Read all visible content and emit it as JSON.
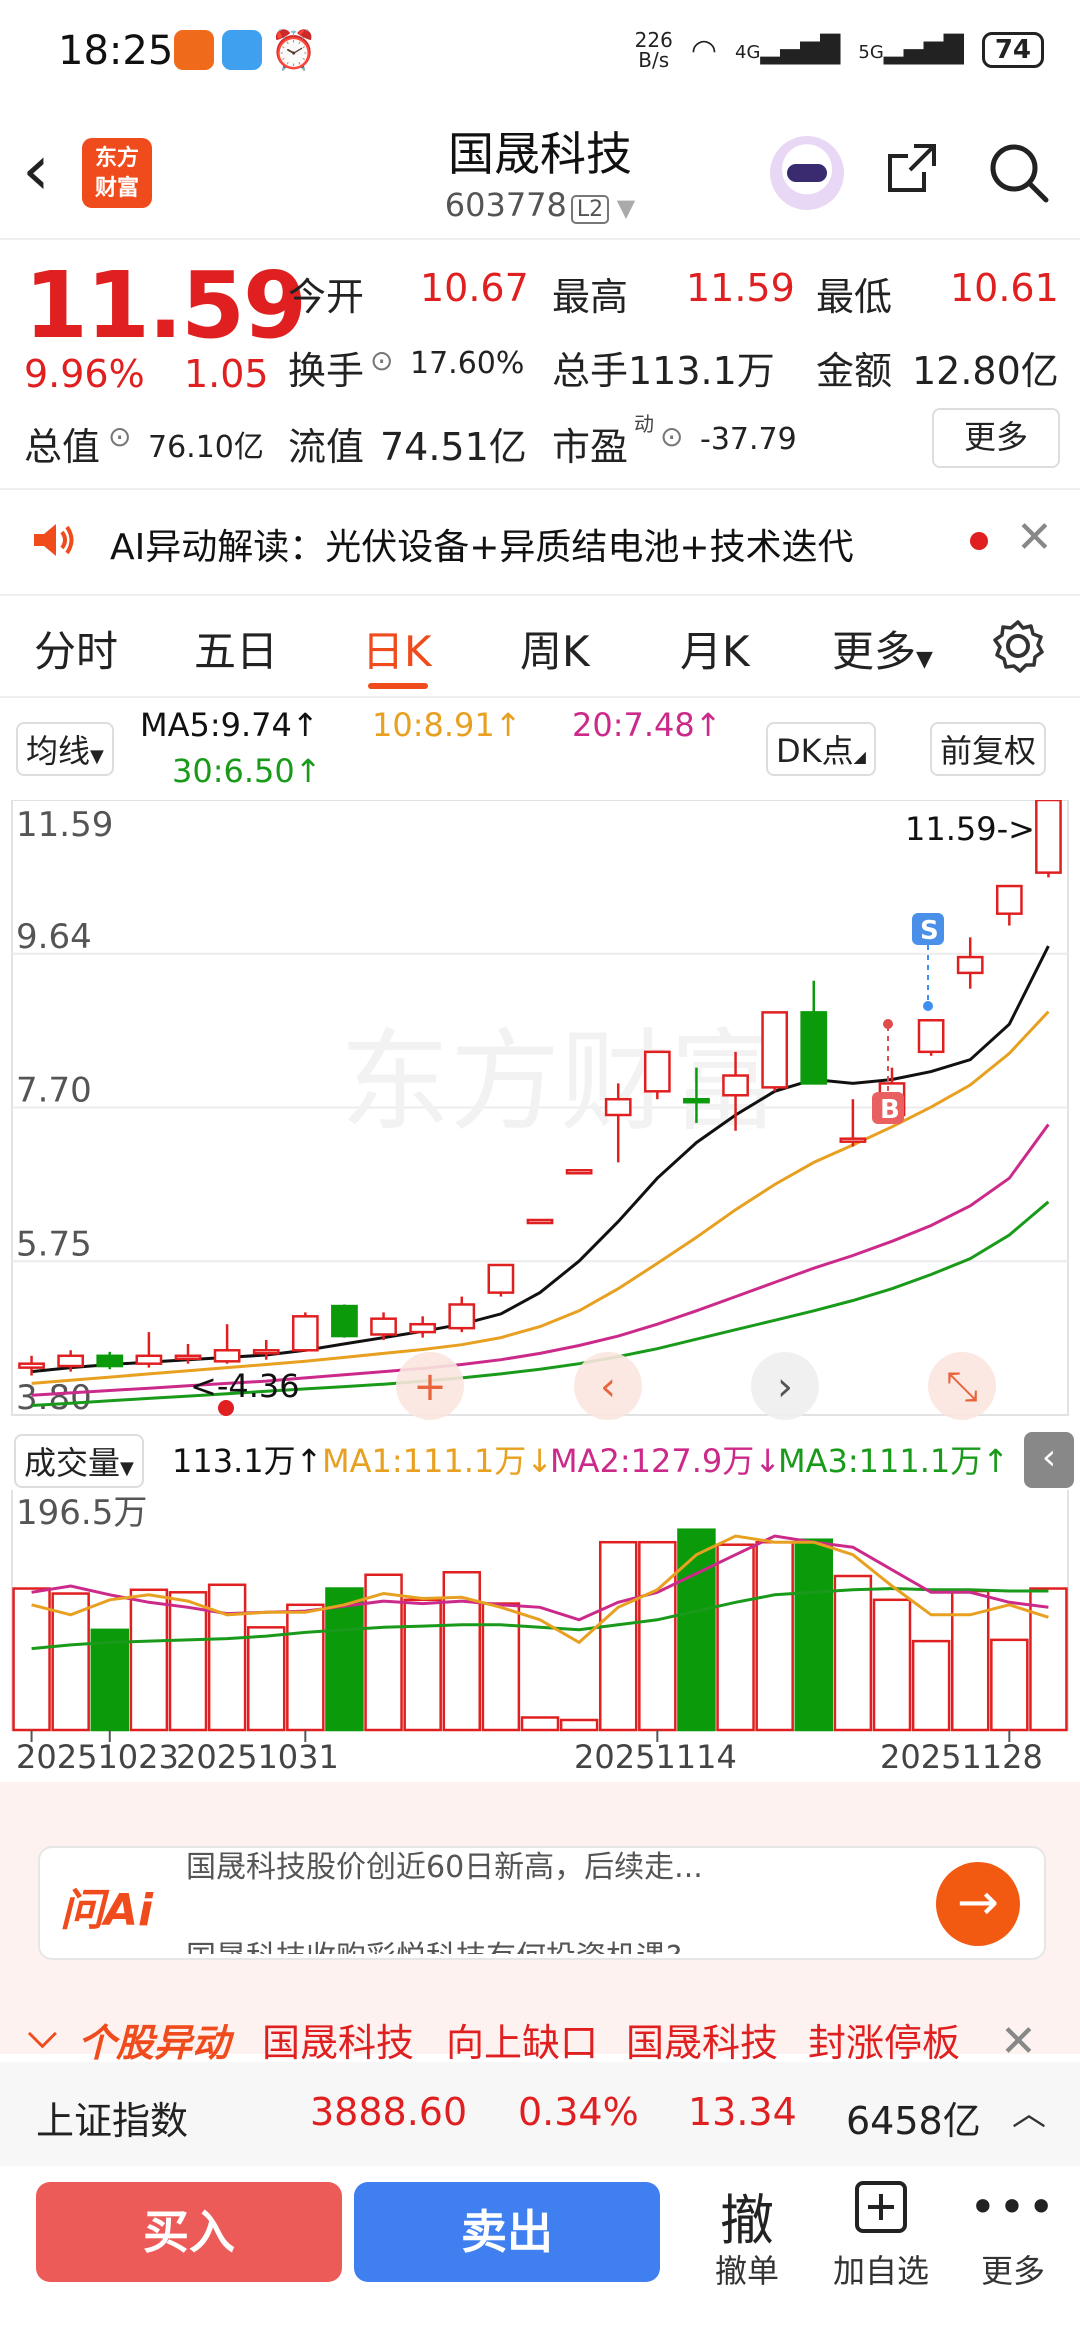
{
  "status_bar": {
    "time": "18:25",
    "net_speed_top": "226",
    "net_speed_bottom": "B/s",
    "sig1": "4G",
    "sig2": "5G",
    "battery": "74"
  },
  "header": {
    "logo_text": "东方财富",
    "stock_name": "国晟科技",
    "stock_code": "603778",
    "level_badge": "L2"
  },
  "quote": {
    "price": "11.59",
    "change_pct": "9.96%",
    "change": "1.05",
    "open_label": "今开",
    "open": "10.67",
    "high_label": "最高",
    "high": "11.59",
    "low_label": "最低",
    "low": "10.61",
    "turnover_label": "换手",
    "turnover": "17.60%",
    "volume_label": "总手",
    "volume": "113.1万",
    "amount_label": "金额",
    "amount": "12.80亿",
    "total_cap_label": "总值",
    "total_cap": "76.10亿",
    "float_cap_label": "流值",
    "float_cap": "74.51亿",
    "pe_label": "市盈",
    "pe_sup": "动",
    "pe": "-37.79",
    "more_label": "更多"
  },
  "ai_banner": {
    "text": "AI异动解读：光伏设备+异质结电池+技术迭代"
  },
  "tabs": [
    {
      "label": "分时"
    },
    {
      "label": "五日"
    },
    {
      "label": "日K"
    },
    {
      "label": "周K"
    },
    {
      "label": "月K"
    },
    {
      "label": "更多"
    }
  ],
  "ma_indicator": {
    "selector": "均线",
    "ma5": "MA5:9.74↑",
    "ma10": "10:8.91↑",
    "ma20": "20:7.48↑",
    "ma30": "30:6.50↑",
    "dk_button": "DK点",
    "adjust_button": "前复权"
  },
  "vol_indicator": {
    "selector": "成交量",
    "vol": "113.1万↑",
    "ma1": "MA1:111.1万↓",
    "ma2": "MA2:127.9万↓",
    "ma3": "MA3:111.1万↑",
    "top_label": "196.5万"
  },
  "colors": {
    "up": "#e02020",
    "down": "#0a9a0a",
    "ma5": "#111111",
    "ma10": "#e8a020",
    "ma20": "#cc2a8a",
    "ma30": "#1a9a1a",
    "brand": "#f04b1c"
  },
  "chart_data": {
    "type": "candlestick",
    "y_ticks": [
      "11.59",
      "9.64",
      "7.70",
      "5.75",
      "3.80"
    ],
    "ylim": [
      3.8,
      11.59
    ],
    "x_ticks": [
      "20251023",
      "20251031",
      "20251114",
      "20251128"
    ],
    "max_marker": "11.59->",
    "min_marker": "<-4.36",
    "signal_sell": "S",
    "signal_buy": "B",
    "candles": [
      {
        "o": 4.4,
        "c": 4.45,
        "h": 4.55,
        "l": 4.3
      },
      {
        "o": 4.42,
        "c": 4.55,
        "h": 4.62,
        "l": 4.35
      },
      {
        "o": 4.55,
        "c": 4.42,
        "h": 4.6,
        "l": 4.38
      },
      {
        "o": 4.45,
        "c": 4.55,
        "h": 4.85,
        "l": 4.4
      },
      {
        "o": 4.52,
        "c": 4.55,
        "h": 4.7,
        "l": 4.45
      },
      {
        "o": 4.48,
        "c": 4.62,
        "h": 4.95,
        "l": 4.45
      },
      {
        "o": 4.6,
        "c": 4.62,
        "h": 4.75,
        "l": 4.5
      },
      {
        "o": 4.62,
        "c": 5.05,
        "h": 5.1,
        "l": 4.6
      },
      {
        "o": 5.18,
        "c": 4.8,
        "h": 5.2,
        "l": 4.78
      },
      {
        "o": 4.82,
        "c": 5.02,
        "h": 5.1,
        "l": 4.75
      },
      {
        "o": 4.85,
        "c": 4.95,
        "h": 5.05,
        "l": 4.78
      },
      {
        "o": 4.9,
        "c": 5.2,
        "h": 5.3,
        "l": 4.85
      },
      {
        "o": 5.35,
        "c": 5.7,
        "h": 5.7,
        "l": 5.3
      },
      {
        "o": 6.27,
        "c": 6.27,
        "h": 6.27,
        "l": 6.27
      },
      {
        "o": 6.9,
        "c": 6.9,
        "h": 6.9,
        "l": 6.9
      },
      {
        "o": 7.6,
        "c": 7.8,
        "h": 8.0,
        "l": 7.0
      },
      {
        "o": 7.9,
        "c": 8.4,
        "h": 8.4,
        "l": 7.8
      },
      {
        "o": 7.8,
        "c": 7.78,
        "h": 8.2,
        "l": 7.5
      },
      {
        "o": 7.85,
        "c": 8.1,
        "h": 8.4,
        "l": 7.4
      },
      {
        "o": 7.95,
        "c": 8.9,
        "h": 8.9,
        "l": 7.9
      },
      {
        "o": 8.9,
        "c": 8.0,
        "h": 9.3,
        "l": 8.0
      },
      {
        "o": 7.3,
        "c": 7.3,
        "h": 7.8,
        "l": 7.2
      },
      {
        "o": 7.6,
        "c": 8.0,
        "h": 8.2,
        "l": 7.5
      },
      {
        "o": 8.4,
        "c": 8.8,
        "h": 8.8,
        "l": 8.35
      },
      {
        "o": 9.4,
        "c": 9.6,
        "h": 9.85,
        "l": 9.2
      },
      {
        "o": 10.15,
        "c": 10.5,
        "h": 10.5,
        "l": 10.0
      },
      {
        "o": 10.67,
        "c": 11.59,
        "h": 11.59,
        "l": 10.61
      }
    ],
    "ma5": [
      4.35,
      4.4,
      4.44,
      4.47,
      4.5,
      4.53,
      4.56,
      4.62,
      4.7,
      4.78,
      4.86,
      4.95,
      5.08,
      5.35,
      5.75,
      6.25,
      6.8,
      7.25,
      7.6,
      7.9,
      8.05,
      8.0,
      8.05,
      8.15,
      8.3,
      8.75,
      9.74
    ],
    "ma10": [
      4.2,
      4.24,
      4.28,
      4.32,
      4.36,
      4.4,
      4.44,
      4.48,
      4.53,
      4.58,
      4.63,
      4.69,
      4.78,
      4.92,
      5.12,
      5.4,
      5.72,
      6.05,
      6.4,
      6.72,
      7.0,
      7.22,
      7.45,
      7.7,
      7.98,
      8.38,
      8.91
    ],
    "ma20": [
      4.05,
      4.08,
      4.11,
      4.14,
      4.17,
      4.2,
      4.23,
      4.27,
      4.31,
      4.35,
      4.39,
      4.44,
      4.5,
      4.58,
      4.68,
      4.8,
      4.95,
      5.12,
      5.3,
      5.48,
      5.66,
      5.82,
      6.0,
      6.2,
      6.45,
      6.8,
      7.48
    ],
    "ma30": [
      3.92,
      3.95,
      3.98,
      4.01,
      4.04,
      4.07,
      4.1,
      4.13,
      4.16,
      4.19,
      4.23,
      4.27,
      4.32,
      4.38,
      4.45,
      4.54,
      4.64,
      4.76,
      4.88,
      5.0,
      5.12,
      5.25,
      5.4,
      5.58,
      5.78,
      6.08,
      6.5
    ],
    "volume": [
      113,
      109,
      80,
      112,
      110,
      116,
      82,
      100,
      113,
      124,
      104,
      126,
      101,
      10,
      8,
      150,
      150,
      160,
      148,
      150,
      152,
      123,
      104,
      71,
      111,
      72,
      113
    ],
    "vol_ma1": [
      100,
      92,
      104,
      108,
      103,
      92,
      94,
      94,
      100,
      109,
      105,
      106,
      98,
      88,
      70,
      98,
      112,
      140,
      155,
      150,
      150,
      140,
      115,
      92,
      92,
      100,
      90
    ],
    "vol_ma2": [
      110,
      115,
      108,
      102,
      98,
      93,
      94,
      95,
      99,
      103,
      101,
      103,
      100,
      98,
      88,
      102,
      110,
      125,
      140,
      155,
      150,
      146,
      128,
      110,
      110,
      102,
      98
    ],
    "vol_ma3": [
      65,
      68,
      70,
      71,
      72,
      73,
      75,
      78,
      80,
      82,
      83,
      84,
      84,
      82,
      80,
      84,
      88,
      95,
      102,
      108,
      110,
      112,
      113,
      112,
      112,
      111,
      111
    ],
    "vol_ylim": [
      0,
      196.5
    ]
  },
  "ask_ai": {
    "logo": "问Ai",
    "q1": "国晟科技股价创近60日新高，后续走...",
    "q2": "国晟科技收购彩悦科技有何投资机遇?"
  },
  "movement": {
    "label": "个股异动",
    "item1_name": "国晟科技",
    "item1_tag": "向上缺口",
    "item2_name": "国晟科技",
    "item2_tag": "封涨停板"
  },
  "index_bar": {
    "name": "上证指数",
    "value": "3888.60",
    "pct": "0.34%",
    "change": "13.34",
    "amount": "6458亿"
  },
  "actions": {
    "buy": "买入",
    "sell": "卖出",
    "cancel_glyph": "撤",
    "cancel": "撤单",
    "add_watch": "加自选",
    "more": "更多"
  }
}
